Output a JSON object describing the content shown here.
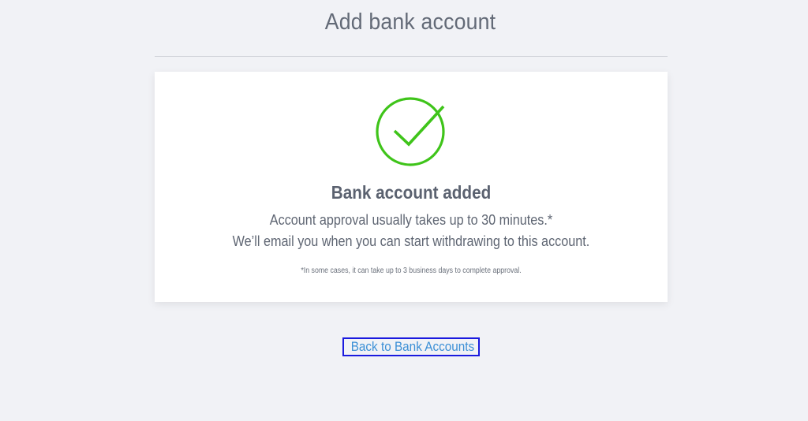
{
  "header": {
    "title": "Add bank account"
  },
  "card": {
    "icon": "check-circle-icon",
    "icon_color": "#3fc41a",
    "heading": "Bank account added",
    "line_1": "Account approval usually takes up to 30 minutes.*",
    "line_2": "We’ll email you when you can start withdrawing to this account.",
    "note": "*In some cases, it can take up to 3 business days to complete approval."
  },
  "footer": {
    "back_link_label": "Back to Bank Accounts",
    "link_color": "#3b8fd6"
  }
}
